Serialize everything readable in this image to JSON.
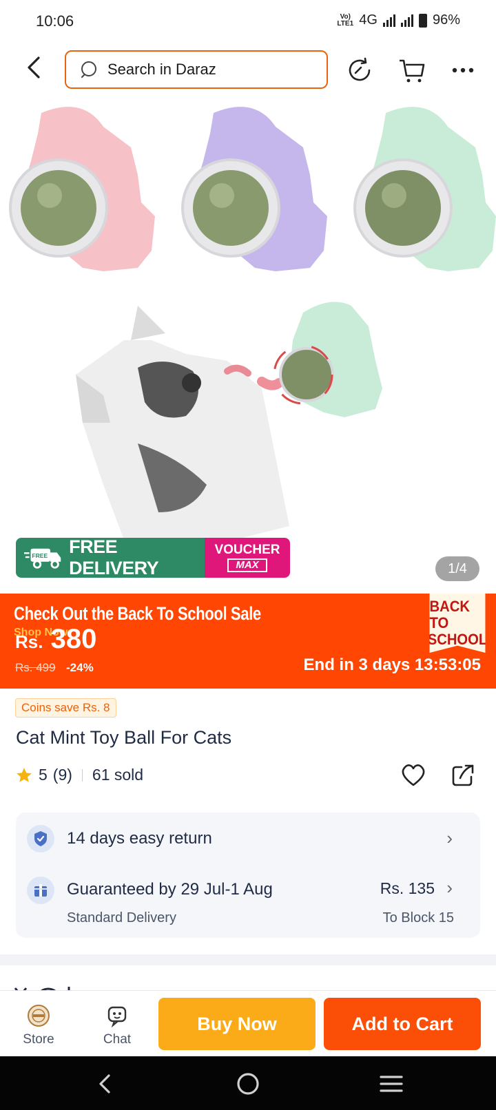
{
  "status_bar": {
    "time": "10:06",
    "network": "4G",
    "lte_label": "Vo) LTE1",
    "battery": "96%"
  },
  "header": {
    "search_placeholder": "Search in Daraz",
    "icons": [
      "back-arrow-icon",
      "search-icon",
      "history-icon",
      "cart-icon",
      "more-icon"
    ]
  },
  "gallery": {
    "free_delivery_tag": "FREE",
    "free_delivery_label": "FREE DELIVERY",
    "voucher_line1": "VOUCHER",
    "voucher_line2": "MAX",
    "counter": "1/4"
  },
  "sale": {
    "title": "Check Out the Back To School Sale",
    "shop_now": "Shop Now",
    "currency": "Rs.",
    "price": "380",
    "original_price": "Rs. 499",
    "discount": "-24%",
    "ends_in": "End in 3 days 13:53:05",
    "badge_line1": "BACK TO",
    "badge_line2": "SCHOOL",
    "colors": {
      "banner": "#ff4603",
      "badge_text": "#c4150f"
    }
  },
  "product": {
    "coins": "Coins save Rs. 8",
    "title": "Cat Mint Toy Ball For Cats",
    "rating": "5",
    "rating_count": "(9)",
    "sold": "61 sold"
  },
  "service": {
    "return_label": "14 days easy return",
    "delivery_label": "Guaranteed by 29 Jul-1 Aug",
    "delivery_type": "Standard Delivery",
    "delivery_fee": "Rs. 135",
    "delivery_location": "To Block 15"
  },
  "bottom_bar": {
    "store_label": "Store",
    "chat_label": "Chat",
    "buy_now": "Buy Now",
    "add_to_cart": "Add to Cart",
    "colors": {
      "buy_now": "#fbaa18",
      "add_to_cart": "#fb4e07"
    }
  }
}
